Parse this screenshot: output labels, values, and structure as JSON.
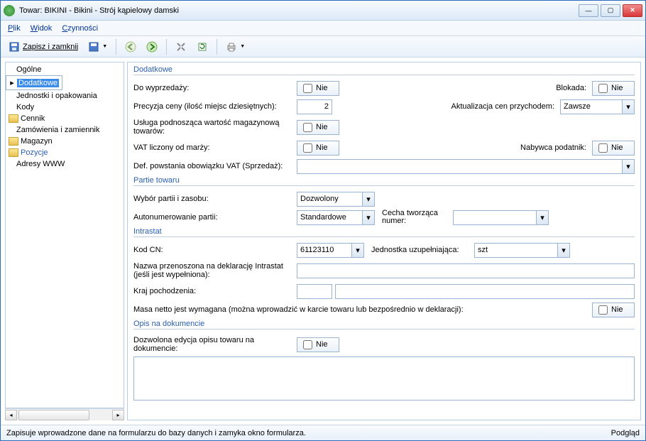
{
  "title": "Towar: BIKINI - Bikini - Strój kąpielowy damski",
  "menu": {
    "plik": "Plik",
    "widok": "Widok",
    "czynnosci": "Czynności"
  },
  "toolbar": {
    "save": "Zapisz i zamknij"
  },
  "tree": {
    "ogolne": "Ogólne",
    "dodatkowe": "Dodatkowe",
    "jednostki": "Jednostki i opakowania",
    "kody": "Kody",
    "cennik": "Cennik",
    "zamowienia": "Zamówienia i zamiennik",
    "magazyn": "Magazyn",
    "pozycje": "Pozycje",
    "adresy": "Adresy WWW"
  },
  "groups": {
    "dodatkowe": "Dodatkowe",
    "partie": "Partie towaru",
    "intrastat": "Intrastat",
    "opis": "Opis na dokumencie"
  },
  "labels": {
    "doWyprzedazy": "Do wyprzedaży:",
    "blokada": "Blokada:",
    "precyzja": "Precyzja ceny (ilość miejsc dziesiętnych):",
    "aktualizacja": "Aktualizacja cen przychodem:",
    "usluga": "Usługa podnosząca wartość magazynową towarów:",
    "vatMarza": "VAT liczony od marży:",
    "nabywca": "Nabywca podatnik:",
    "defVat": "Def. powstania obowiązku VAT (Sprzedaż):",
    "wybor": "Wybór partii i zasobu:",
    "autonum": "Autonumerowanie partii:",
    "cecha": "Cecha tworząca numer:",
    "kodCN": "Kod CN:",
    "jednostka": "Jednostka uzupełniająca:",
    "nazwaIntra": "Nazwa przenoszona na deklarację Intrastat (jeśli jest wypełniona):",
    "kraj": "Kraj pochodzenia:",
    "masa": "Masa netto jest wymagana (można wprowadzić w karcie towaru lub bezpośrednio w deklaracji):",
    "dozwolona": "Dozwolona edycja opisu towaru na dokumencie:"
  },
  "values": {
    "nie": "Nie",
    "precyzja": "2",
    "zawsze": "Zawsze",
    "dozwolony": "Dozwolony",
    "standardowe": "Standardowe",
    "kodCN": "61123110",
    "szt": "szt",
    "nazwaIntra": "",
    "kraj1": "",
    "kraj2": "",
    "defVat": "",
    "cecha": "",
    "opis": ""
  },
  "status": {
    "left": "Zapisuje wprowadzone dane na formularzu do bazy danych i zamyka okno formularza.",
    "right": "Podgląd"
  }
}
